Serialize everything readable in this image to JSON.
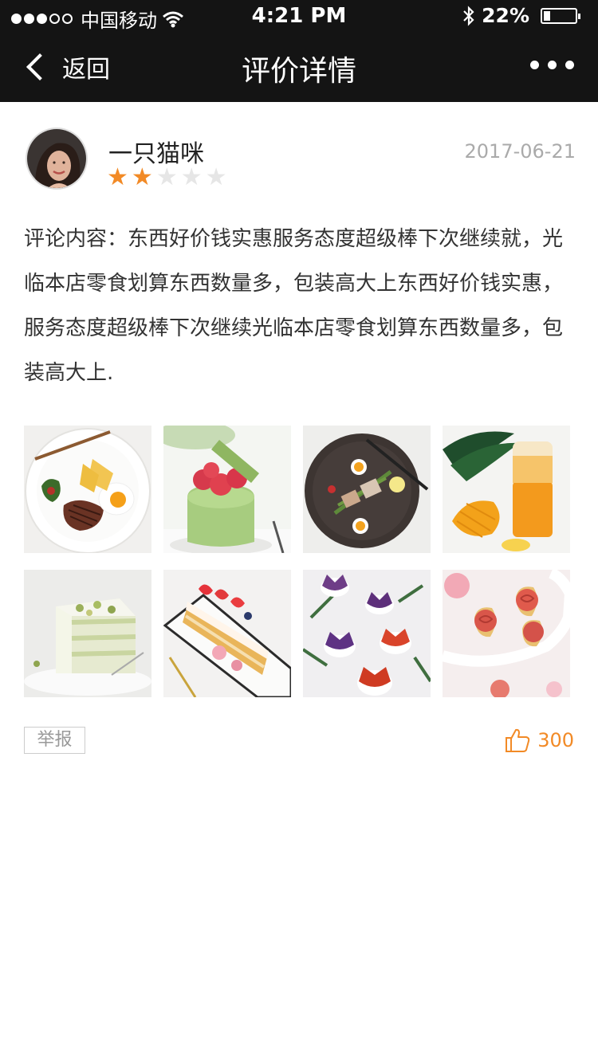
{
  "status_bar": {
    "carrier": "中国移动",
    "time": "4:21 PM",
    "battery_percent": "22%",
    "battery_level": 0.22,
    "signal_bars_filled": 3,
    "signal_bars_total": 5
  },
  "nav": {
    "back_label": "返回",
    "title": "评价详情",
    "more_icon": "more-dots-icon"
  },
  "review": {
    "username": "一只猫咪",
    "date": "2017-06-21",
    "rating": 2,
    "rating_max": 5,
    "comment": "评论内容：东西好价钱实惠服务态度超级棒下次继续就，光临本店零食划算东西数量多，包装高大上东西好价钱实惠，服务态度超级棒下次继续光临本店零食划算东西数量多，包装高大上."
  },
  "gallery": [
    "steak-plate-photo",
    "matcha-raspberry-cake-photo",
    "salad-plate-photo",
    "mango-drink-photo",
    "pistachio-cake-photo",
    "strawberry-cake-photo",
    "fox-cupcakes-photo",
    "rose-tarts-photo"
  ],
  "actions": {
    "report_label": "举报",
    "like_count": "300"
  },
  "colors": {
    "header_bg": "#141414",
    "accent": "#f28a26"
  }
}
